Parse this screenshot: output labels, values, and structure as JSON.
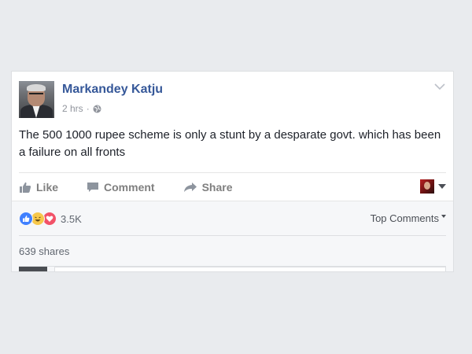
{
  "post": {
    "author": "Markandey Katju",
    "time": "2 hrs",
    "separator": "·",
    "text": "The 500 1000 rupee scheme is only a stunt by a desparate govt. which has been a failure on all fronts"
  },
  "actions": {
    "like": "Like",
    "comment": "Comment",
    "share": "Share"
  },
  "reactions": {
    "types": [
      "like",
      "haha",
      "love"
    ],
    "count": "3.5K"
  },
  "comments": {
    "sort_label": "Top Comments"
  },
  "shares": {
    "count_label": "639 shares"
  },
  "colors": {
    "page_bg": "#e9ebee",
    "author_link": "#365899",
    "like_blue": "#4080ff",
    "haha_yellow": "#f7c84b",
    "love_red": "#f25268"
  },
  "icons": [
    "globe-icon",
    "chevron-down-icon",
    "like-icon",
    "comment-icon",
    "share-icon"
  ]
}
